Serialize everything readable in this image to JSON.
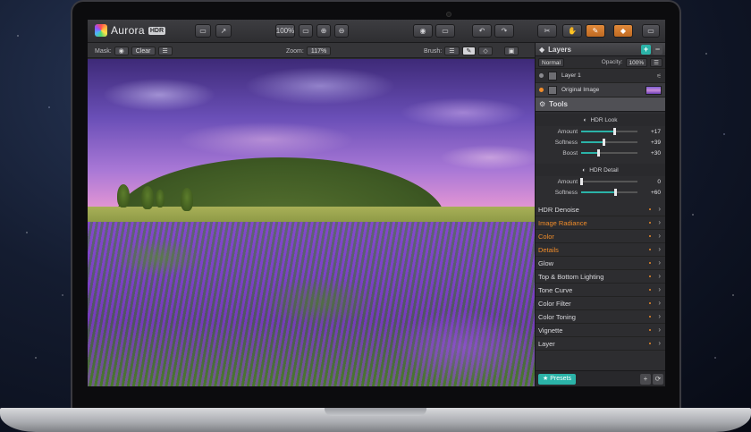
{
  "app": {
    "name": "Aurora",
    "badge": "HDR"
  },
  "toolbar": {
    "zoom_button": "100%",
    "undo_icon": "undo-icon",
    "redo_icon": "redo-icon"
  },
  "subbar": {
    "mask_label": "Mask:",
    "clear_label": "Clear",
    "zoom_label": "Zoom:",
    "zoom_value": "117%",
    "brush_label": "Brush:"
  },
  "layers": {
    "title": "Layers",
    "blend_mode": "Normal",
    "opacity_label": "Opacity:",
    "opacity_value": "100%",
    "items": [
      {
        "name": "Layer 1"
      },
      {
        "name": "Original Image"
      }
    ]
  },
  "tools": {
    "title": "Tools",
    "hdr_look": {
      "title": "HDR Look",
      "sliders": [
        {
          "label": "Amount",
          "value": "+17",
          "level": 0.58
        },
        {
          "label": "Softness",
          "value": "+39",
          "level": 0.39
        },
        {
          "label": "Boost",
          "value": "+30",
          "level": 0.3
        }
      ]
    },
    "hdr_detail": {
      "title": "HDR Detail",
      "sliders": [
        {
          "label": "Amount",
          "value": "0",
          "level": 0.0
        },
        {
          "label": "Softness",
          "value": "+60",
          "level": 0.6
        }
      ]
    },
    "filters": [
      {
        "label": "HDR Denoise",
        "highlight": false
      },
      {
        "label": "Image Radiance",
        "highlight": true
      },
      {
        "label": "Color",
        "highlight": true
      },
      {
        "label": "Details",
        "highlight": true
      },
      {
        "label": "Glow",
        "highlight": false
      },
      {
        "label": "Top & Bottom Lighting",
        "highlight": false
      },
      {
        "label": "Tone Curve",
        "highlight": false
      },
      {
        "label": "Color Filter",
        "highlight": false
      },
      {
        "label": "Color Toning",
        "highlight": false
      },
      {
        "label": "Vignette",
        "highlight": false
      },
      {
        "label": "Layer",
        "highlight": false
      }
    ]
  },
  "footer": {
    "presets_label": "Presets"
  },
  "colors": {
    "accent": "#2bb3a8",
    "highlight": "#f08c2a",
    "active_tool": "#e0893a"
  }
}
